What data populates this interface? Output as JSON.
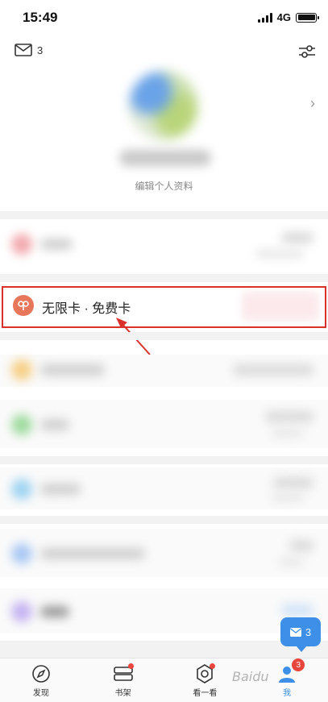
{
  "status_bar": {
    "time": "15:49",
    "network": "4G"
  },
  "header": {
    "mail_count": "3",
    "edit_profile": "编辑个人资料"
  },
  "card": {
    "label": "无限卡 · 免费卡",
    "icon_color": "#e8765b"
  },
  "float_message": {
    "count": "3"
  },
  "bottom_nav": {
    "items": [
      {
        "label": "发现",
        "icon": "compass-icon"
      },
      {
        "label": "书架",
        "icon": "bookshelf-icon"
      },
      {
        "label": "看一看",
        "icon": "look-icon"
      },
      {
        "label": "我",
        "icon": "profile-icon",
        "badge": "3"
      }
    ]
  },
  "watermark": "Baidu",
  "colors": {
    "accent": "#3d8fe8",
    "highlight": "#d9312c",
    "badge": "#e8453c"
  }
}
